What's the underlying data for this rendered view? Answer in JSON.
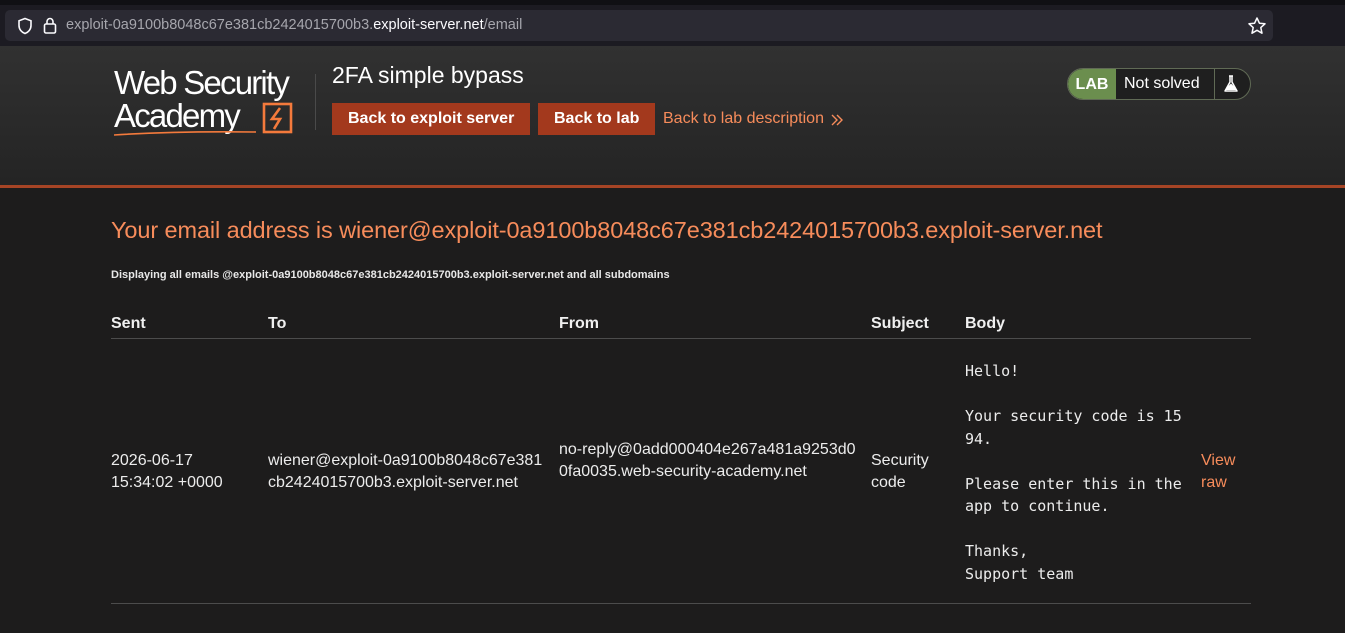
{
  "browser": {
    "url_prefix": "exploit-0a9100b8048c67e381cb2424015700b3.",
    "url_host": "exploit-server.net",
    "url_path": "/email"
  },
  "header": {
    "logo_line1": "Web Security",
    "logo_line2": "Academy",
    "lab_title": "2FA simple bypass",
    "btn_exploit": "Back to exploit server",
    "btn_lab": "Back to lab",
    "desc_link": "Back to lab description",
    "status_badge": "LAB",
    "status_text": "Not solved"
  },
  "main": {
    "heading": "Your email address is wiener@exploit-0a9100b8048c67e381cb2424015700b3.exploit-server.net",
    "subtitle": "Displaying all emails @exploit-0a9100b8048c67e381cb2424015700b3.exploit-server.net and all subdomains",
    "columns": {
      "sent": "Sent",
      "to": "To",
      "from": "From",
      "subject": "Subject",
      "body": "Body"
    },
    "emails": [
      {
        "sent": "2026-06-17 15:34:02 +0000",
        "to": "wiener@exploit-0a9100b8048c67e381cb2424015700b3.exploit-server.net",
        "from": "no-reply@0add000404e267a481a9253d00fa0035.web-security-academy.net",
        "subject": "Security code",
        "body": "Hello!\n\nYour security code is 1594.\n\nPlease enter this in the app to continue.\n\nThanks,\nSupport team",
        "view_raw": "View raw"
      }
    ]
  },
  "colors": {
    "accent": "#f78c5b",
    "button": "#a3391d",
    "lab_green": "#6b8e4e"
  }
}
